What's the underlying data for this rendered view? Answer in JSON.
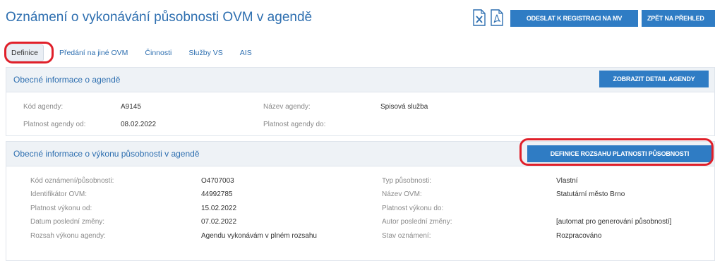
{
  "header": {
    "title": "Oznámení o vykonávání působnosti OVM v agendě",
    "send_button": "ODESLAT K REGISTRACI NA MV",
    "back_button": "ZPĚT NA PŘEHLED"
  },
  "tabs": [
    "Definice",
    "Předání na jiné OVM",
    "Činnosti",
    "Služby VS",
    "AIS"
  ],
  "agenda_section": {
    "title": "Obecné informace o agendě",
    "detail_button": "ZOBRAZIT DETAIL AGENDY",
    "fields": {
      "code_label": "Kód agendy:",
      "code_value": "A9145",
      "name_label": "Název agendy:",
      "name_value": "Spisová služba",
      "valid_from_label": "Platnost agendy od:",
      "valid_from_value": "08.02.2022",
      "valid_to_label": "Platnost agendy do:",
      "valid_to_value": ""
    }
  },
  "execution_section": {
    "title": "Obecné informace o výkonu působnosti v agendě",
    "definition_button": "DEFINICE ROZSAHU PLATNOSTI PŮSOBNOSTI",
    "fields": {
      "notice_code_label": "Kód oznámení/působnosti:",
      "notice_code_value": "O4707003",
      "type_label": "Typ působnosti:",
      "type_value": "Vlastní",
      "ovm_id_label": "Identifikátor OVM:",
      "ovm_id_value": "44992785",
      "ovm_name_label": "Název OVM:",
      "ovm_name_value": "Statutární město Brno",
      "exec_from_label": "Platnost výkonu od:",
      "exec_from_value": "15.02.2022",
      "exec_to_label": "Platnost výkonu do:",
      "exec_to_value": "",
      "last_change_label": "Datum poslední změny:",
      "last_change_value": "07.02.2022",
      "author_label": "Autor poslední změny:",
      "author_value": "[automat pro generování působností]",
      "scope_label": "Rozsah výkonu agendy:",
      "scope_value": "Agendu vykonávám v plném rozsahu",
      "state_label": "Stav oznámení:",
      "state_value": "Rozpracováno"
    }
  },
  "icons": [
    "excel-icon",
    "pdf-icon"
  ],
  "colors": {
    "accent": "#2f7cc4",
    "title": "#2e6fb0",
    "highlight": "#e0202a"
  }
}
